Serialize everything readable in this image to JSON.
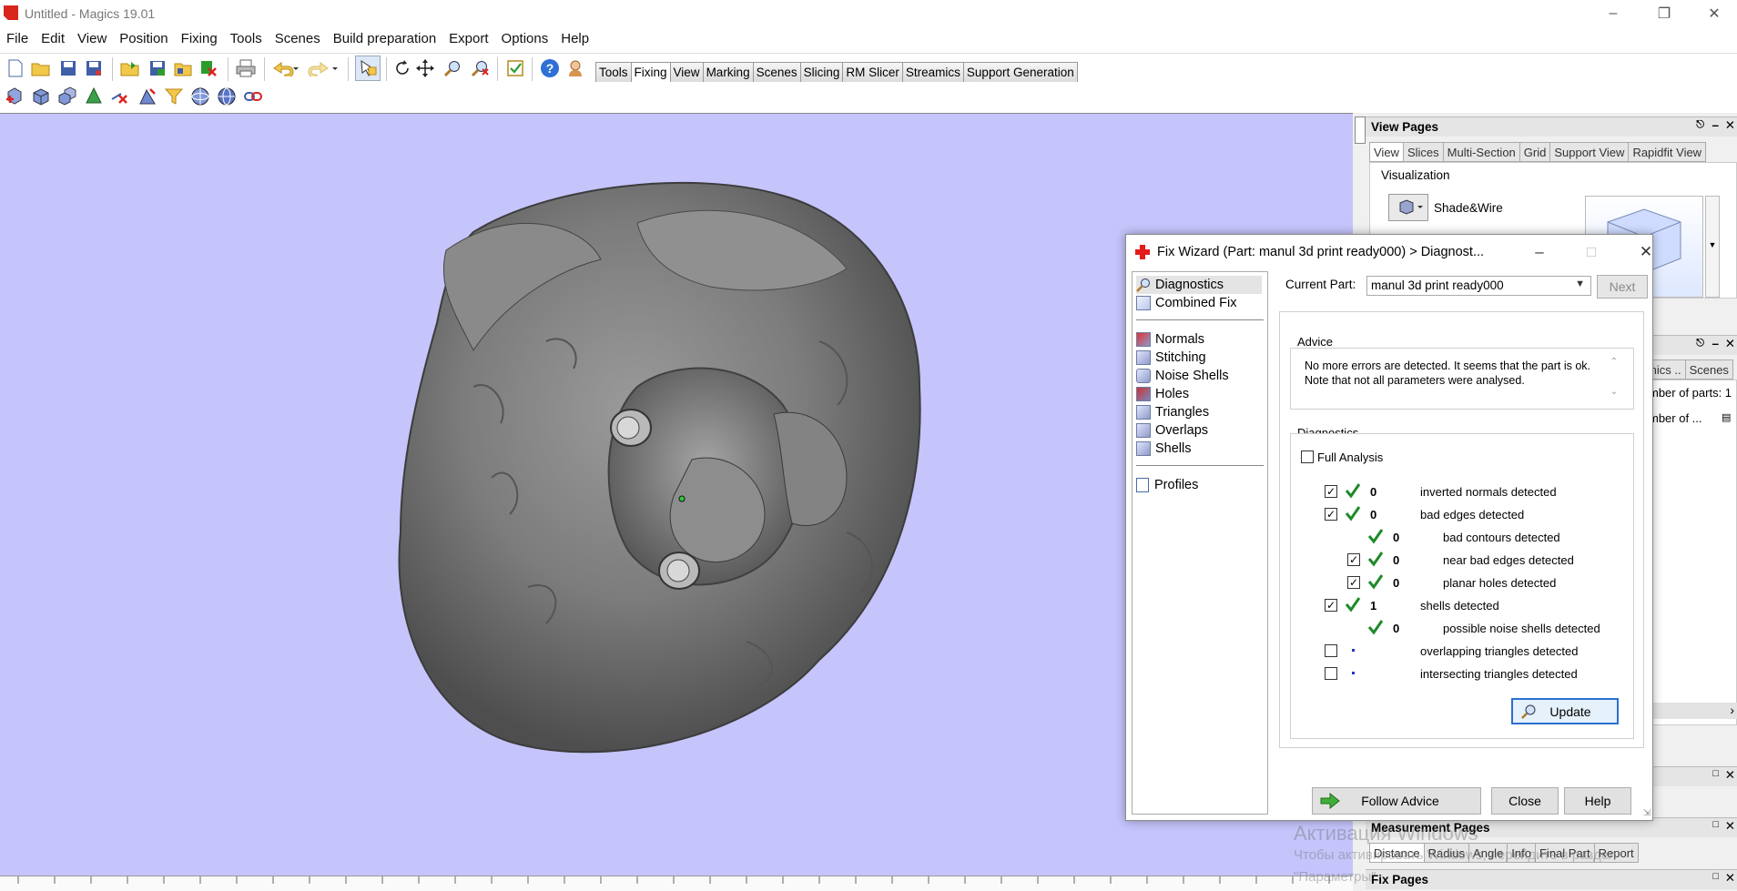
{
  "window": {
    "title": "Untitled - Magics 19.01"
  },
  "menu": [
    "File",
    "Edit",
    "View",
    "Position",
    "Fixing",
    "Tools",
    "Scenes",
    "Build preparation",
    "Export",
    "Options",
    "Help"
  ],
  "toolbar_tabs": [
    "Tools",
    "Fixing",
    "View",
    "Marking",
    "Scenes",
    "Slicing",
    "RM Slicer",
    "Streamics",
    "Support Generation"
  ],
  "dock": {
    "view_pages": {
      "title": "View Pages",
      "tabs": [
        "View",
        "Slices",
        "Multi-Section",
        "Grid",
        "Support View",
        "Rapidfit View"
      ],
      "visualization_label": "Visualization",
      "mode": "Shade&Wire"
    },
    "middle_panel": {
      "tabs": [
        "mics ..",
        "Scenes"
      ],
      "row1": "mber of parts: 1",
      "row2": "mber of ..."
    },
    "measurement_pages": {
      "title": "Measurement Pages",
      "tabs": [
        "Distance",
        "Radius",
        "Angle",
        "Info",
        "Final Part",
        "Report"
      ]
    },
    "fix_pages": {
      "title": "Fix Pages"
    }
  },
  "dialog": {
    "title": "Fix Wizard (Part: manul 3d print ready000) > Diagnost...",
    "nav": {
      "top": [
        "Diagnostics",
        "Combined Fix"
      ],
      "middle": [
        "Normals",
        "Stitching",
        "Noise Shells",
        "Holes",
        "Triangles",
        "Overlaps",
        "Shells"
      ],
      "bottom": [
        "Profiles"
      ]
    },
    "current_part_label": "Current Part:",
    "current_part_value": "manul 3d print ready000",
    "next_label": "Next",
    "advice_label": "Advice",
    "advice_text": "No more errors are detected. It seems that the part is ok. Note that not all parameters were analysed.",
    "diagnostics_label": "Diagnostics",
    "full_analysis_label": "Full Analysis",
    "rows": [
      {
        "count": "0",
        "text": "inverted normals detected"
      },
      {
        "count": "0",
        "text": "bad edges detected"
      },
      {
        "count": "0",
        "text": "bad contours detected"
      },
      {
        "count": "0",
        "text": "near bad edges detected"
      },
      {
        "count": "0",
        "text": "planar holes detected"
      },
      {
        "count": "1",
        "text": "shells detected"
      },
      {
        "count": "0",
        "text": "possible noise shells detected"
      },
      {
        "count": "",
        "text": "overlapping triangles detected"
      },
      {
        "count": "",
        "text": "intersecting triangles detected"
      }
    ],
    "update_label": "Update",
    "follow_advice_label": "Follow Advice",
    "close_label": "Close",
    "help_label": "Help"
  },
  "watermark": {
    "line1": "Активация Windows",
    "line2": "Чтобы активировать Windows, перейдите в раздел",
    "line3": "\"Параметры\"."
  },
  "colors": {
    "viewport": "#c5c4fb",
    "check": "#1f8a2a",
    "accent": "#d9261c"
  }
}
